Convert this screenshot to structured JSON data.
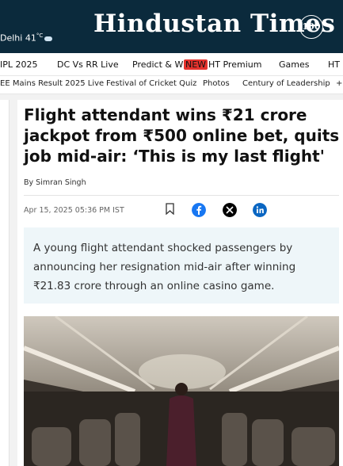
{
  "header": {
    "weather_city": "Delhi",
    "weather_temp": "41",
    "weather_unit": "°C",
    "logo_text": "Hindustan Times",
    "badge": "100"
  },
  "nav_primary": [
    "IPL 2025",
    "DC Vs RR Live",
    "Predict & Win",
    "HT Premium",
    "Games",
    "HT P"
  ],
  "nav_primary_new_tag": "NEW",
  "nav_secondary": [
    "EE Mains Result 2025 Live",
    "Festival of Cricket Quiz",
    "Photos",
    "Century of Leadership",
    "+"
  ],
  "article": {
    "headline": "Flight attendant wins ₹21 crore jackpot from ₹500 online bet, quits job mid-air: ‘This is my last flight'",
    "byline": "By Simran Singh",
    "date": "Apr 15, 2025 05:36 PM IST",
    "summary": "A young flight attendant shocked passengers by announcing her resignation mid-air after winning ₹21.83 crore through an online casino game."
  },
  "share": {
    "bookmark_icon": "bookmark-icon",
    "facebook_icon": "facebook-icon",
    "x_icon": "x-icon",
    "linkedin_icon": "linkedin-icon",
    "facebook_color": "#1877f2",
    "x_color": "#000000",
    "linkedin_color": "#0a66c2"
  },
  "colors": {
    "header_bg": "#0b2a3c",
    "summary_bg": "#eef6f9",
    "new_tag": "#e5322d"
  }
}
